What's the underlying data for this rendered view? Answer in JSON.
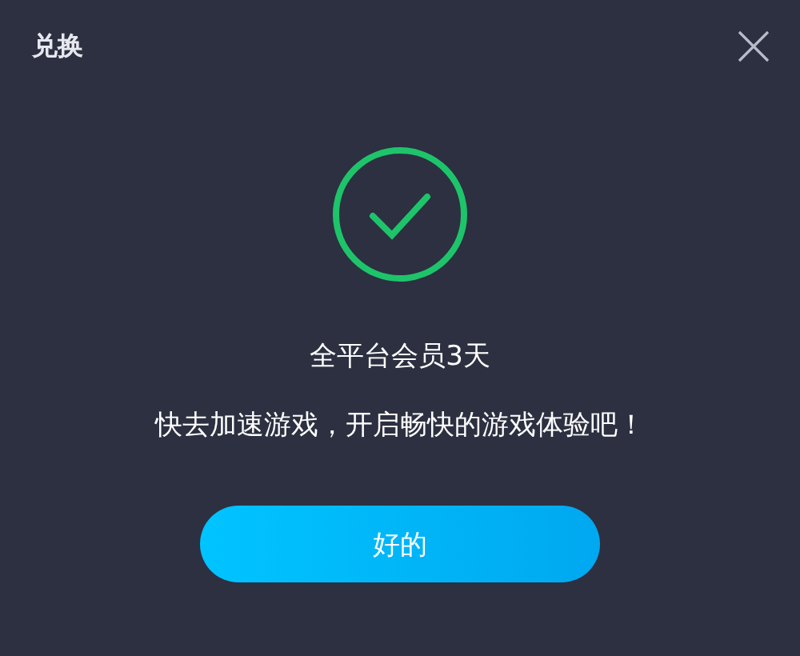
{
  "window": {
    "title": "兑换"
  },
  "result": {
    "title": "全平台会员3天",
    "message": "快去加速游戏，开启畅快的游戏体验吧！"
  },
  "buttons": [
    "好的"
  ]
}
